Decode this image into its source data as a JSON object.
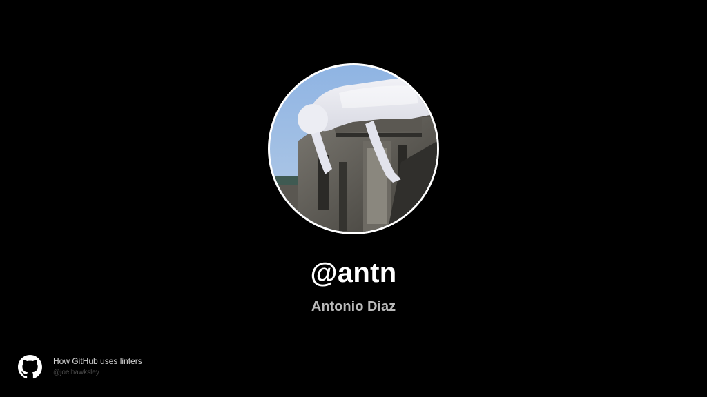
{
  "profile": {
    "username": "@antn",
    "full_name": "Antonio Diaz",
    "avatar_subject": "white-inflatable-figure-on-building-photo"
  },
  "footer": {
    "icon": "github-octocat-icon",
    "talk_title": "How GitHub uses linters",
    "speaker_handle": "@joelhawksley"
  },
  "colors": {
    "background": "#000000",
    "username": "#ffffff",
    "full_name": "#b9b9b9",
    "footer_title": "#d4d4d4",
    "footer_handle": "#4c4c4c",
    "avatar_ring": "#ffffff"
  }
}
